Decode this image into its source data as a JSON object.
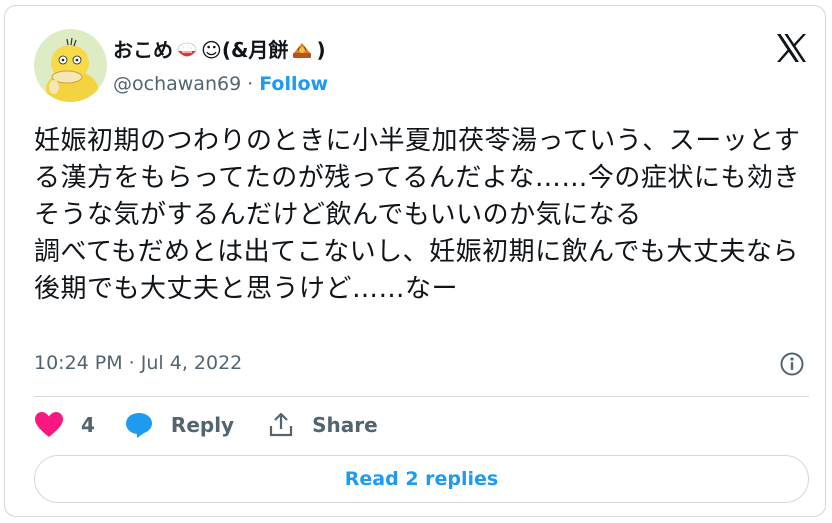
{
  "author": {
    "display_name_prefix": "おこめ",
    "display_name_middle": "☺(&月餅",
    "display_name_suffix": ")",
    "name_emojis": [
      "rice-bowl-emoji",
      "mooncake-emoji"
    ],
    "handle": "@ochawan69",
    "separator": "·",
    "follow_label": "Follow"
  },
  "tweet": {
    "text": "妊娠初期のつわりのときに小半夏加茯苓湯っていう、スーッとする漢方をもらってたのが残ってるんだよな……今の症状にも効きそうな気がするんだけど飲んでもいいのか気になる\n調べてもだめとは出てこないし、妊娠初期に飲んでも大丈夫なら後期でも大丈夫と思うけど……なー",
    "timestamp": "10:24 PM · Jul 4, 2022"
  },
  "actions": {
    "like_count": "4",
    "reply_label": "Reply",
    "share_label": "Share"
  },
  "read_replies_label": "Read 2 replies",
  "colors": {
    "accent": "#1d9bf0",
    "like": "#f91880",
    "text": "#0f1419",
    "secondary": "#536471",
    "border": "#cfd9de"
  },
  "icons": {
    "platform": "x-logo-icon",
    "info": "info-icon",
    "like": "heart-icon",
    "reply": "reply-bubble-icon",
    "share": "share-icon"
  }
}
